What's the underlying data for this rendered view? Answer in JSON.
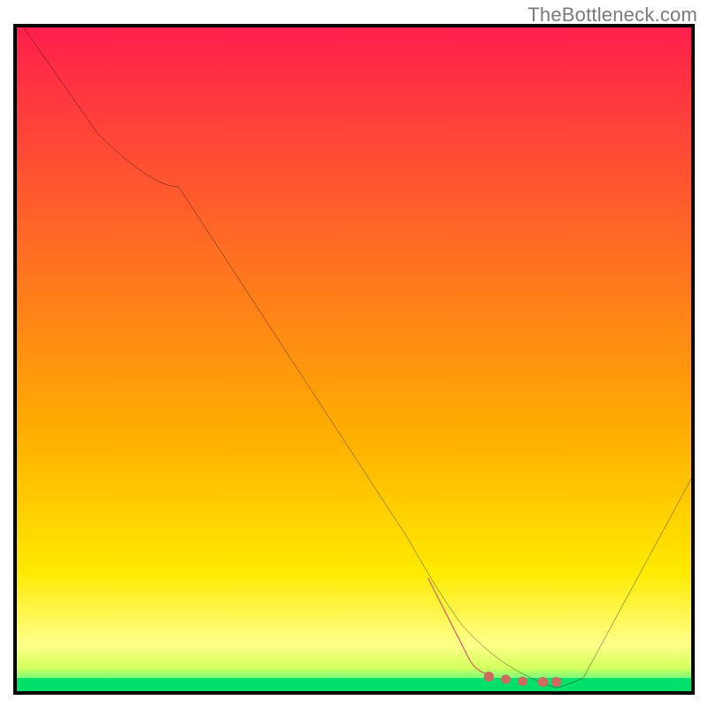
{
  "watermark": "TheBottleneck.com",
  "chart_data": {
    "type": "line",
    "title": "",
    "xlabel": "",
    "ylabel": "",
    "xlim": [
      0,
      100
    ],
    "ylim": [
      0,
      100
    ],
    "grid": false,
    "legend": false,
    "background": {
      "bands": [
        {
          "y_from": 100,
          "y_to": 38,
          "color_top": "#ff1f4c",
          "color_bottom": "#ffb000"
        },
        {
          "y_from": 38,
          "y_to": 18,
          "color_top": "#ffb000",
          "color_bottom": "#ffea00"
        },
        {
          "y_from": 18,
          "y_to": 7,
          "color_top": "#ffea00",
          "color_bottom": "#ffff8a"
        },
        {
          "y_from": 7,
          "y_to": 3.5,
          "color_top": "#ffff8a",
          "color_bottom": "#d2ff5a"
        },
        {
          "y_from": 3.5,
          "y_to": 2.0,
          "color_top": "#d2ff5a",
          "color_bottom": "#7bff7b"
        },
        {
          "y_from": 2.0,
          "y_to": 0.0,
          "color_top": "#00e06a",
          "color_bottom": "#00e06a"
        }
      ]
    },
    "series": [
      {
        "name": "bottleneck-curve",
        "style": "solid-black",
        "x": [
          1,
          12,
          24,
          58,
          66,
          72,
          80,
          84,
          100
        ],
        "y": [
          100,
          84,
          76,
          23,
          10,
          3,
          0.5,
          2,
          32
        ]
      },
      {
        "name": "highlight-region",
        "style": "red-dashed-thick",
        "x": [
          61,
          65,
          67,
          70,
          73,
          76,
          80
        ],
        "y": [
          17,
          9,
          5,
          2.5,
          1.8,
          1.5,
          1.4
        ]
      }
    ],
    "annotations": []
  }
}
